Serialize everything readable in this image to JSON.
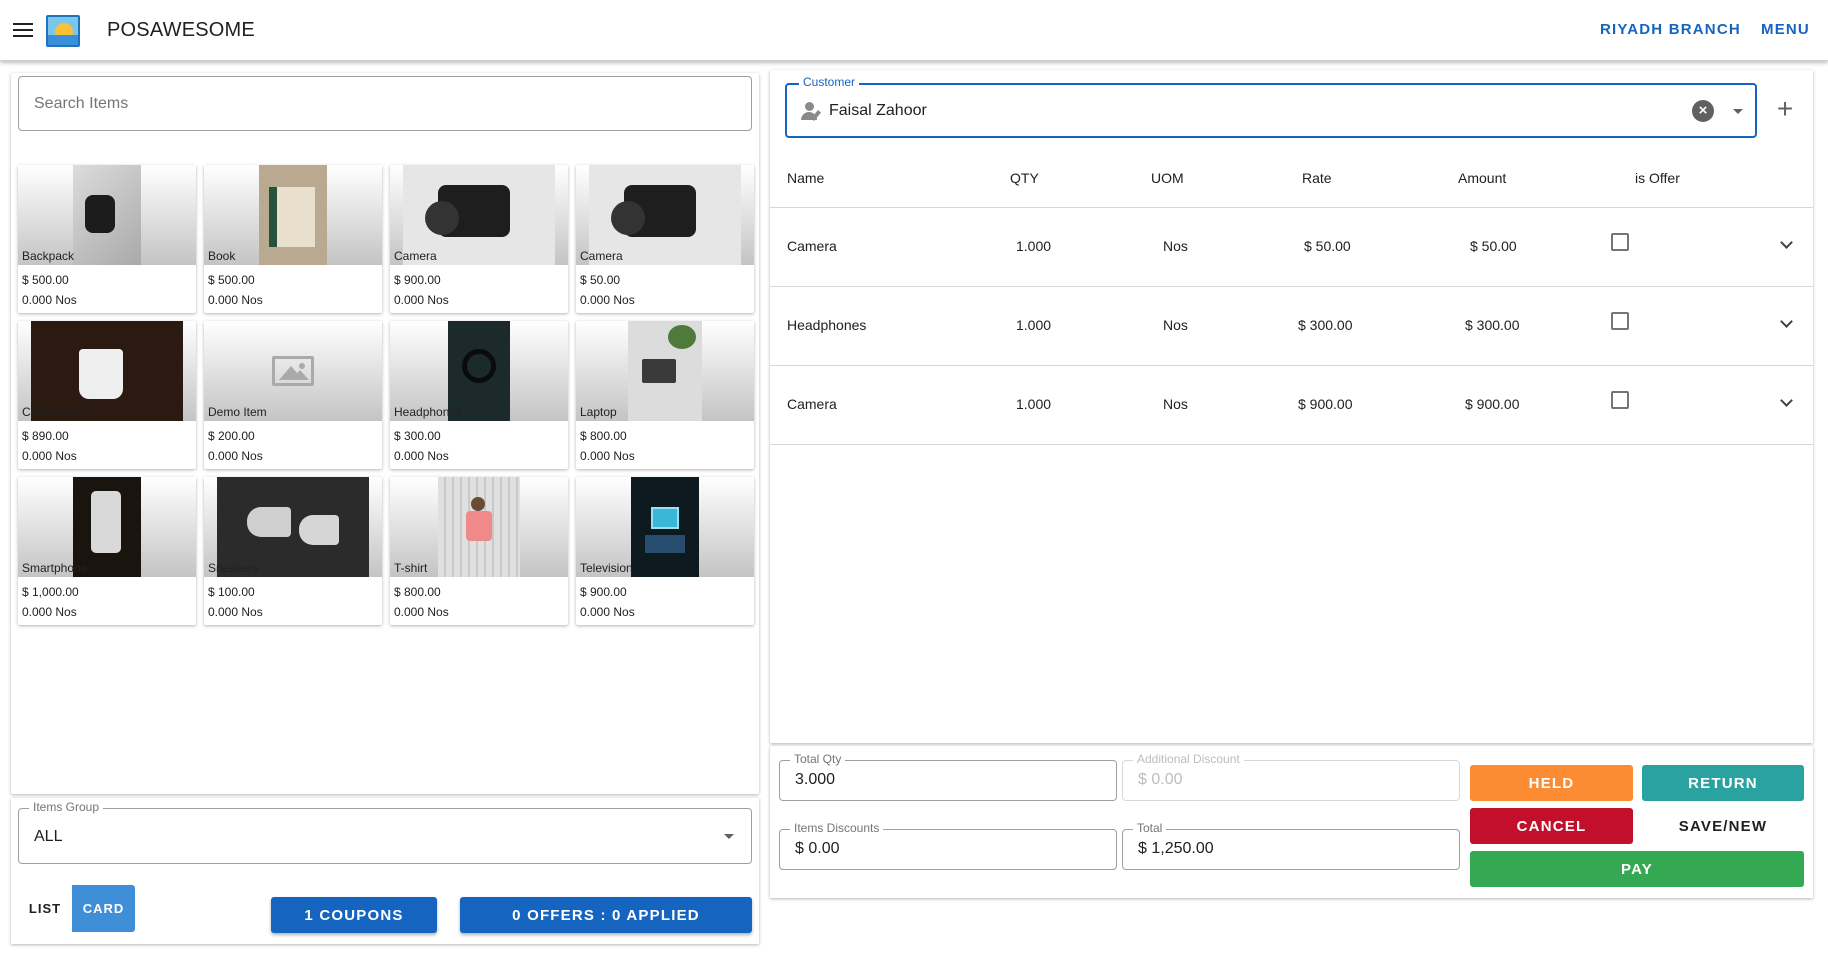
{
  "app": {
    "title": "POSAWESOME",
    "branch": "RIYADH BRANCH",
    "menu": "MENU"
  },
  "search": {
    "placeholder": "Search Items",
    "value": ""
  },
  "items": [
    {
      "name": "Backpack",
      "price": "$ 500.00",
      "stock": "0.000 Nos"
    },
    {
      "name": "Book",
      "price": "$ 500.00",
      "stock": "0.000 Nos"
    },
    {
      "name": "Camera",
      "price": "$ 900.00",
      "stock": "0.000 Nos"
    },
    {
      "name": "Camera",
      "price": "$ 50.00",
      "stock": "0.000 Nos"
    },
    {
      "name": "Coffee Mug",
      "price": "$ 890.00",
      "stock": "0.000 Nos"
    },
    {
      "name": "Demo Item",
      "price": "$ 200.00",
      "stock": "0.000 Nos"
    },
    {
      "name": "Headphones",
      "price": "$ 300.00",
      "stock": "0.000 Nos"
    },
    {
      "name": "Laptop",
      "price": "$ 800.00",
      "stock": "0.000 Nos"
    },
    {
      "name": "Smartphone",
      "price": "$ 1,000.00",
      "stock": "0.000 Nos"
    },
    {
      "name": "Sneakers",
      "price": "$ 100.00",
      "stock": "0.000 Nos"
    },
    {
      "name": "T-shirt",
      "price": "$ 800.00",
      "stock": "0.000 Nos"
    },
    {
      "name": "Television",
      "price": "$ 900.00",
      "stock": "0.000 Nos"
    }
  ],
  "items_group": {
    "label": "Items Group",
    "value": "ALL"
  },
  "view_toggle": {
    "list": "LIST",
    "card": "CARD",
    "active": "CARD"
  },
  "coupons_btn": "1 COUPONS",
  "offers_btn": "0 OFFERS : 0 APPLIED",
  "customer": {
    "label": "Customer",
    "value": "Faisal Zahoor"
  },
  "table": {
    "headers": {
      "name": "Name",
      "qty": "QTY",
      "uom": "UOM",
      "rate": "Rate",
      "amount": "Amount",
      "offer": "is Offer"
    },
    "rows": [
      {
        "name": "Camera",
        "qty": "1.000",
        "uom": "Nos",
        "rate": "$ 50.00",
        "amount": "$ 50.00",
        "is_offer": false
      },
      {
        "name": "Headphones",
        "qty": "1.000",
        "uom": "Nos",
        "rate": "$ 300.00",
        "amount": "$ 300.00",
        "is_offer": false
      },
      {
        "name": "Camera",
        "qty": "1.000",
        "uom": "Nos",
        "rate": "$ 900.00",
        "amount": "$ 900.00",
        "is_offer": false
      }
    ]
  },
  "totals": {
    "total_qty": {
      "label": "Total Qty",
      "value": "3.000"
    },
    "additional_discount": {
      "label": "Additional Discount",
      "value": "$  0.00"
    },
    "items_discounts": {
      "label": "Items Discounts",
      "value": "$  0.00"
    },
    "total": {
      "label": "Total",
      "value": "$  1,250.00"
    }
  },
  "actions": {
    "held": "HELD",
    "return": "RETURN",
    "cancel": "CANCEL",
    "save_new": "SAVE/NEW",
    "pay": "PAY"
  },
  "colors": {
    "primary": "#1565c0",
    "held": "#fb8c33",
    "return": "#2aa3a0",
    "cancel": "#c10f2c",
    "pay": "#34a853",
    "card_toggle": "#3e8ed8"
  },
  "icons": {
    "menu": "hamburger-icon",
    "customer": "person-edit-icon",
    "clear": "close-circle-icon",
    "add": "plus-icon",
    "expand": "chevron-down-icon",
    "dropdown": "caret-down-icon",
    "placeholder": "image-placeholder-icon"
  }
}
